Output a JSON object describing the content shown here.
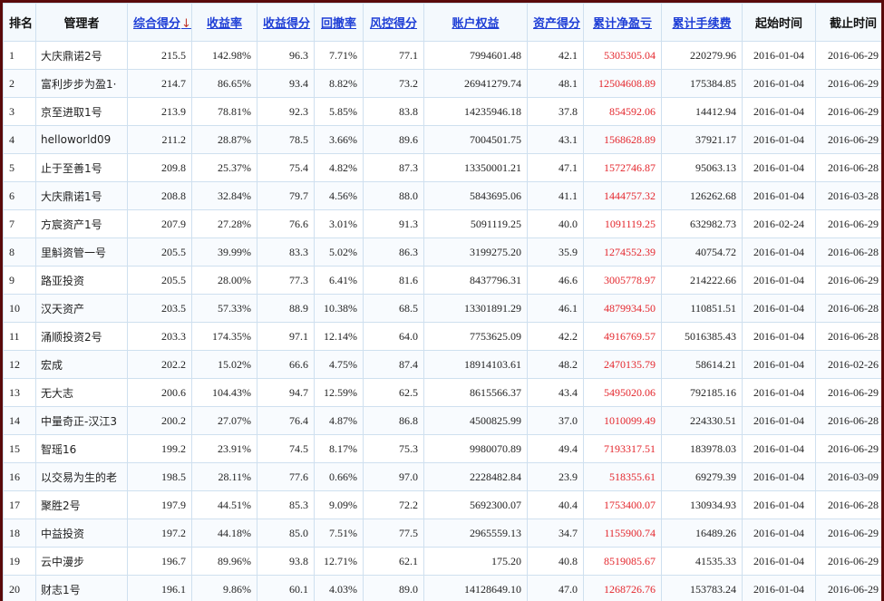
{
  "headers": [
    {
      "key": "rank",
      "label": "排名",
      "link": false
    },
    {
      "key": "manager",
      "label": "管理者",
      "link": false
    },
    {
      "key": "total_score",
      "label": "综合得分",
      "link": true,
      "sort_arrow": "↓"
    },
    {
      "key": "return_rate",
      "label": "收益率",
      "link": true
    },
    {
      "key": "return_score",
      "label": "收益得分",
      "link": true
    },
    {
      "key": "drawdown",
      "label": "回撤率",
      "link": true
    },
    {
      "key": "risk_score",
      "label": "风控得分",
      "link": true
    },
    {
      "key": "equity",
      "label": "账户权益",
      "link": true
    },
    {
      "key": "asset_score",
      "label": "资产得分",
      "link": true
    },
    {
      "key": "net_pl",
      "label": "累计净盈亏",
      "link": true
    },
    {
      "key": "fees",
      "label": "累计手续费",
      "link": true
    },
    {
      "key": "start",
      "label": "起始时间",
      "link": false
    },
    {
      "key": "end",
      "label": "截止时间",
      "link": false
    }
  ],
  "rows": [
    [
      "1",
      "大庆鼎诺2号",
      "215.5",
      "142.98%",
      "96.3",
      "7.71%",
      "77.1",
      "7994601.48",
      "42.1",
      "5305305.04",
      "220279.96",
      "2016-01-04",
      "2016-06-29"
    ],
    [
      "2",
      "富利步步为盈1·",
      "214.7",
      "86.65%",
      "93.4",
      "8.82%",
      "73.2",
      "26941279.74",
      "48.1",
      "12504608.89",
      "175384.85",
      "2016-01-04",
      "2016-06-29"
    ],
    [
      "3",
      "京至进取1号",
      "213.9",
      "78.81%",
      "92.3",
      "5.85%",
      "83.8",
      "14235946.18",
      "37.8",
      "854592.06",
      "14412.94",
      "2016-01-04",
      "2016-06-29"
    ],
    [
      "4",
      "helloworld09",
      "211.2",
      "28.87%",
      "78.5",
      "3.66%",
      "89.6",
      "7004501.75",
      "43.1",
      "1568628.89",
      "37921.17",
      "2016-01-04",
      "2016-06-29"
    ],
    [
      "5",
      "止于至善1号",
      "209.8",
      "25.37%",
      "75.4",
      "4.82%",
      "87.3",
      "13350001.21",
      "47.1",
      "1572746.87",
      "95063.13",
      "2016-01-04",
      "2016-06-28"
    ],
    [
      "6",
      "大庆鼎诺1号",
      "208.8",
      "32.84%",
      "79.7",
      "4.56%",
      "88.0",
      "5843695.06",
      "41.1",
      "1444757.32",
      "126262.68",
      "2016-01-04",
      "2016-03-28"
    ],
    [
      "7",
      "方宸资产1号",
      "207.9",
      "27.28%",
      "76.6",
      "3.01%",
      "91.3",
      "5091119.25",
      "40.0",
      "1091119.25",
      "632982.73",
      "2016-02-24",
      "2016-06-29"
    ],
    [
      "8",
      "里斛资管一号",
      "205.5",
      "39.99%",
      "83.3",
      "5.02%",
      "86.3",
      "3199275.20",
      "35.9",
      "1274552.39",
      "40754.72",
      "2016-01-04",
      "2016-06-28"
    ],
    [
      "9",
      "路亚投资",
      "205.5",
      "28.00%",
      "77.3",
      "6.41%",
      "81.6",
      "8437796.31",
      "46.6",
      "3005778.97",
      "214222.66",
      "2016-01-04",
      "2016-06-29"
    ],
    [
      "10",
      "汉天资产",
      "203.5",
      "57.33%",
      "88.9",
      "10.38%",
      "68.5",
      "13301891.29",
      "46.1",
      "4879934.50",
      "110851.51",
      "2016-01-04",
      "2016-06-28"
    ],
    [
      "11",
      "涌顺投资2号",
      "203.3",
      "174.35%",
      "97.1",
      "12.14%",
      "64.0",
      "7753625.09",
      "42.2",
      "4916769.57",
      "5016385.43",
      "2016-01-04",
      "2016-06-28"
    ],
    [
      "12",
      "宏成",
      "202.2",
      "15.02%",
      "66.6",
      "4.75%",
      "87.4",
      "18914103.61",
      "48.2",
      "2470135.79",
      "58614.21",
      "2016-01-04",
      "2016-02-26"
    ],
    [
      "13",
      "无大志",
      "200.6",
      "104.43%",
      "94.7",
      "12.59%",
      "62.5",
      "8615566.37",
      "43.4",
      "5495020.06",
      "792185.16",
      "2016-01-04",
      "2016-06-29"
    ],
    [
      "14",
      "中量奇正-汉江3",
      "200.2",
      "27.07%",
      "76.4",
      "4.87%",
      "86.8",
      "4500825.99",
      "37.0",
      "1010099.49",
      "224330.51",
      "2016-01-04",
      "2016-06-28"
    ],
    [
      "15",
      "智瑶16",
      "199.2",
      "23.91%",
      "74.5",
      "8.17%",
      "75.3",
      "9980070.89",
      "49.4",
      "7193317.51",
      "183978.03",
      "2016-01-04",
      "2016-06-29"
    ],
    [
      "16",
      "以交易为生的老",
      "198.5",
      "28.11%",
      "77.6",
      "0.66%",
      "97.0",
      "2228482.84",
      "23.9",
      "518355.61",
      "69279.39",
      "2016-01-04",
      "2016-03-09"
    ],
    [
      "17",
      "聚胜2号",
      "197.9",
      "44.51%",
      "85.3",
      "9.09%",
      "72.2",
      "5692300.07",
      "40.4",
      "1753400.07",
      "130934.93",
      "2016-01-04",
      "2016-06-28"
    ],
    [
      "18",
      "中益投资",
      "197.2",
      "44.18%",
      "85.0",
      "7.51%",
      "77.5",
      "2965559.13",
      "34.7",
      "1155900.74",
      "16489.26",
      "2016-01-04",
      "2016-06-29"
    ],
    [
      "19",
      "云中漫步",
      "196.7",
      "89.96%",
      "93.8",
      "12.71%",
      "62.1",
      "175.20",
      "40.8",
      "8519085.67",
      "41535.33",
      "2016-01-04",
      "2016-06-29"
    ],
    [
      "20",
      "财志1号",
      "196.1",
      "9.86%",
      "60.1",
      "4.03%",
      "89.0",
      "14128649.10",
      "47.0",
      "1268726.76",
      "153783.24",
      "2016-01-04",
      "2016-06-29"
    ]
  ],
  "colors": {
    "link": "#1f3fd6",
    "loss_profit": "#e4262c",
    "border": "#cfe0ef",
    "background": "#5a0a0a"
  }
}
